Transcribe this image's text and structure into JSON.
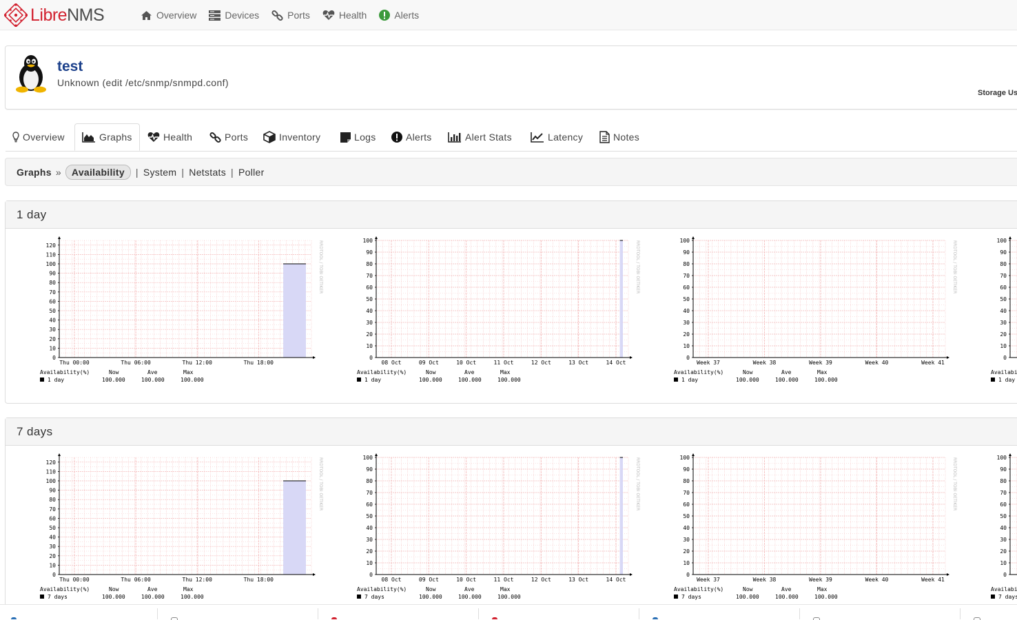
{
  "brand": {
    "part1": "Libre",
    "part2": "NMS"
  },
  "nav": [
    {
      "label": "Overview",
      "icon": "home-icon"
    },
    {
      "label": "Devices",
      "icon": "server-icon"
    },
    {
      "label": "Ports",
      "icon": "link-icon"
    },
    {
      "label": "Health",
      "icon": "heartbeat-icon"
    },
    {
      "label": "Alerts",
      "icon": "exclamation-circle-icon"
    }
  ],
  "device": {
    "name": "test",
    "description": "Unknown (edit /etc/snmp/snmpd.conf)",
    "storage_label": "Storage Us",
    "os_icon": "linux-tux-icon"
  },
  "tabs": [
    {
      "label": "Overview",
      "icon": "lightbulb-icon"
    },
    {
      "label": "Graphs",
      "icon": "area-chart-icon",
      "active": true
    },
    {
      "label": "Health",
      "icon": "heartbeat-icon"
    },
    {
      "label": "Ports",
      "icon": "link-icon"
    },
    {
      "label": "Inventory",
      "icon": "cube-icon"
    },
    {
      "label": "Logs",
      "icon": "sticky-note-icon"
    },
    {
      "label": "Alerts",
      "icon": "exclamation-circle-icon"
    },
    {
      "label": "Alert Stats",
      "icon": "bar-chart-icon"
    },
    {
      "label": "Latency",
      "icon": "line-chart-icon"
    },
    {
      "label": "Notes",
      "icon": "file-text-icon"
    }
  ],
  "subnav": {
    "crumb": "Graphs",
    "separator": "»",
    "active": "Availability",
    "links": [
      "System",
      "Netstats",
      "Poller"
    ]
  },
  "panels": [
    {
      "title": "1 day",
      "legend_period": "1 day"
    },
    {
      "title": "7 days",
      "legend_period": "7 days"
    }
  ],
  "legend": {
    "heading": "Availability(%)",
    "cols": [
      "Now",
      "Ave",
      "Max"
    ],
    "values": [
      "100.000",
      "100.000",
      "100.000"
    ]
  },
  "watermark": "RRDTOOL / TOBI OETIKER",
  "colors": {
    "grid": "#f4b8b8",
    "fill": "#d8d8f6",
    "line": "#000000",
    "brand_red": "#d2212f"
  },
  "chart_data": [
    {
      "type": "area",
      "x": [
        "Thu 00:00",
        "Thu 06:00",
        "Thu 12:00",
        "Thu 18:00"
      ],
      "y_ticks": [
        0,
        10,
        20,
        30,
        40,
        50,
        60,
        70,
        80,
        90,
        100,
        110,
        120
      ],
      "ylim": [
        0,
        125
      ],
      "series": [
        {
          "name": "1 day",
          "values": [
            100
          ]
        }
      ],
      "grid": true
    },
    {
      "type": "area",
      "x": [
        "08 Oct",
        "09 Oct",
        "10 Oct",
        "11 Oct",
        "12 Oct",
        "13 Oct",
        "14 Oct"
      ],
      "y_ticks": [
        0,
        10,
        20,
        30,
        40,
        50,
        60,
        70,
        80,
        90,
        100
      ],
      "ylim": [
        0,
        100
      ],
      "series": [
        {
          "name": "1 day",
          "values": [
            100
          ]
        }
      ],
      "grid": true
    },
    {
      "type": "area",
      "x": [
        "Week 37",
        "Week 38",
        "Week 39",
        "Week 40",
        "Week 41"
      ],
      "y_ticks": [
        0,
        10,
        20,
        30,
        40,
        50,
        60,
        70,
        80,
        90,
        100
      ],
      "ylim": [
        0,
        100
      ],
      "series": [
        {
          "name": "1 day",
          "values": []
        }
      ],
      "grid": true
    },
    {
      "type": "area",
      "x": [],
      "y_ticks": [
        0,
        10,
        20,
        30,
        40,
        50,
        60,
        70,
        80,
        90,
        100
      ],
      "ylim": [
        0,
        100
      ],
      "series": [
        {
          "name": "1 day",
          "values": []
        }
      ],
      "grid": true
    }
  ]
}
